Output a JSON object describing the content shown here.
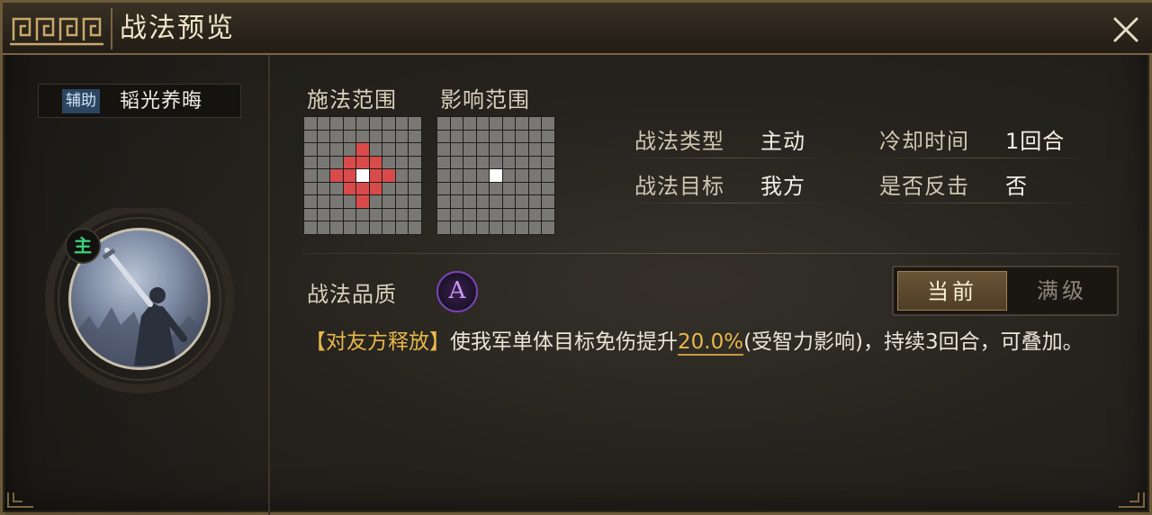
{
  "header": {
    "title": "战法预览"
  },
  "skill": {
    "tag": "辅助",
    "name": "韬光养晦",
    "main_badge": "主"
  },
  "ranges": {
    "cast_label": "施法范围",
    "effect_label": "影响范围"
  },
  "info": {
    "type_label": "战法类型",
    "type_value": "主动",
    "cooldown_label": "冷却时间",
    "cooldown_value": "1回合",
    "target_label": "战法目标",
    "target_value": "我方",
    "counter_label": "是否反击",
    "counter_value": "否"
  },
  "quality": {
    "label": "战法品质",
    "grade": "A"
  },
  "toggle": {
    "current": "当前",
    "max": "满级"
  },
  "description": {
    "tag": "【对友方释放】",
    "part1": "使我军单体目标免伤提升",
    "value": "20.0%",
    "part2": "(受智力影响)，持续3回合，可叠加。"
  },
  "colors": {
    "accent_gold": "#e8b84a",
    "cast_range_red": "#d94b4b",
    "quality_purple": "#7a44b8",
    "main_badge_green": "#3bd47a"
  }
}
